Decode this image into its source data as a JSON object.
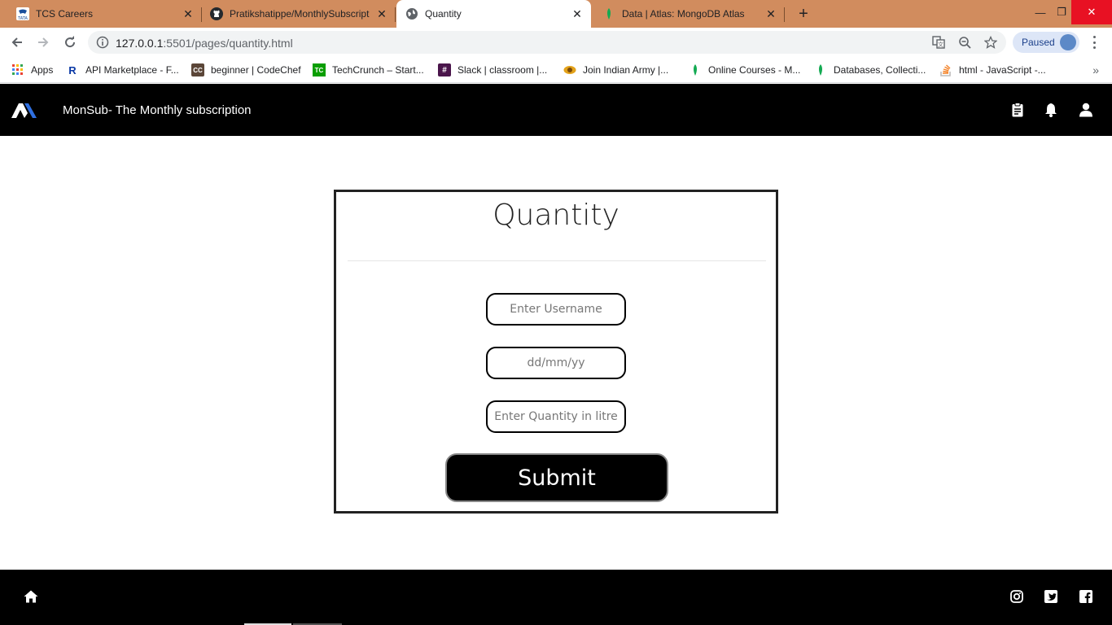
{
  "browser": {
    "tabs": [
      {
        "title": "TCS Careers",
        "icon": "tata-icon",
        "active": false
      },
      {
        "title": "Pratikshatippe/MonthlySubscript",
        "icon": "github-icon",
        "active": false
      },
      {
        "title": "Quantity",
        "icon": "globe-icon",
        "active": true
      },
      {
        "title": "Data | Atlas: MongoDB Atlas",
        "icon": "mongodb-leaf-icon",
        "active": false
      }
    ],
    "address": {
      "host": "127.0.0.1",
      "path": ":5501/pages/quantity.html"
    },
    "profile_status": "Paused",
    "bookmarks": [
      {
        "label": "Apps",
        "icon": "apps-grid-icon"
      },
      {
        "label": "API Marketplace - F...",
        "icon": "rapidapi-icon"
      },
      {
        "label": "beginner | CodeChef",
        "icon": "codechef-icon"
      },
      {
        "label": "TechCrunch – Start...",
        "icon": "techcrunch-icon"
      },
      {
        "label": "Slack | classroom |...",
        "icon": "slack-icon"
      },
      {
        "label": "Join Indian Army |...",
        "icon": "indian-army-icon"
      },
      {
        "label": "Online Courses - M...",
        "icon": "mongodb-leaf-icon"
      },
      {
        "label": "Databases, Collecti...",
        "icon": "mongodb-leaf-icon"
      },
      {
        "label": "html - JavaScript -...",
        "icon": "stackoverflow-icon"
      }
    ],
    "colors": {
      "tabstrip": "#d18c5e",
      "close": "#e81123"
    }
  },
  "app": {
    "brand": "MonSub- The Monthly subscription",
    "header_icons": [
      "clipboard-icon",
      "bell-icon",
      "user-icon"
    ],
    "form": {
      "title": "Quantity",
      "username_placeholder": "Enter Username",
      "date_placeholder": "dd/mm/yy",
      "quantity_placeholder": "Enter Quantity in litre",
      "submit_label": "Submit"
    },
    "footer_icons": [
      "home-icon",
      "instagram-icon",
      "twitter-icon",
      "facebook-icon"
    ],
    "colors": {
      "header": "#000000",
      "footer": "#000000",
      "button": "#000000"
    }
  }
}
